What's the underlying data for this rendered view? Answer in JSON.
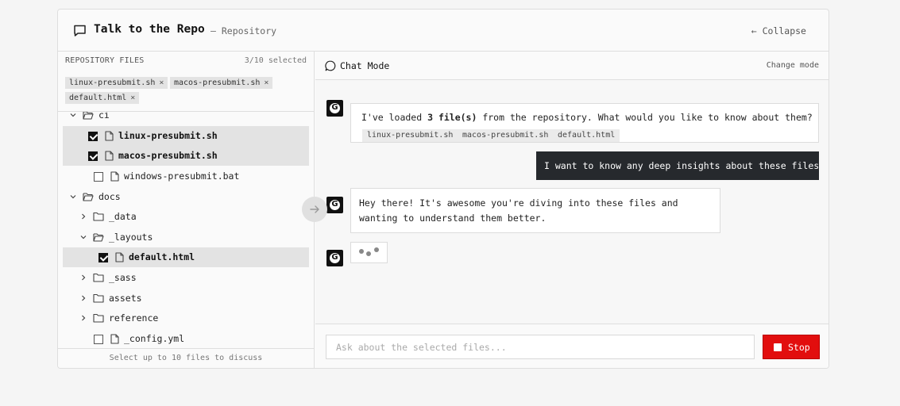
{
  "header": {
    "title": "Talk to the Repo",
    "subtitle": "— Repository",
    "collapse_label": "← Collapse",
    "icon": "chat-bubble-icon"
  },
  "files_panel": {
    "title": "REPOSITORY FILES",
    "selected_count": "3/10 selected",
    "chips": [
      "linux-presubmit.sh",
      "macos-presubmit.sh",
      "default.html"
    ],
    "chip_remove": "×",
    "tree": [
      {
        "label": "ci",
        "type": "folder",
        "expanded": true
      },
      {
        "label": "linux-presubmit.sh",
        "type": "file",
        "checked": true
      },
      {
        "label": "macos-presubmit.sh",
        "type": "file",
        "checked": true
      },
      {
        "label": "windows-presubmit.bat",
        "type": "file",
        "checked": false
      },
      {
        "label": "docs",
        "type": "folder",
        "expanded": true
      },
      {
        "label": "_data",
        "type": "folder",
        "expanded": false
      },
      {
        "label": "_layouts",
        "type": "folder",
        "expanded": true
      },
      {
        "label": "default.html",
        "type": "file",
        "checked": true
      },
      {
        "label": "_sass",
        "type": "folder",
        "expanded": false
      },
      {
        "label": "assets",
        "type": "folder",
        "expanded": false
      },
      {
        "label": "reference",
        "type": "folder",
        "expanded": false
      },
      {
        "label": "_config.yml",
        "type": "file",
        "checked": false
      }
    ],
    "footer": "Select up to 10 files to discuss"
  },
  "chat": {
    "mode_label": "Chat Mode",
    "change_mode": "Change mode",
    "avatar_letter": "G",
    "messages": {
      "m1_pre": "I've loaded ",
      "m1_bold": "3 file(s)",
      "m1_post": " from the repository. What would you like to know about them?",
      "m1_chips": [
        "linux-presubmit.sh",
        "macos-presubmit.sh",
        "default.html"
      ],
      "user": "I want to know any deep insights about these files",
      "m2": "Hey there! It's awesome you're diving into these files and wanting to understand them better."
    },
    "input_placeholder": "Ask about the selected files...",
    "stop_label": "Stop"
  },
  "colors": {
    "accent_stop": "#e20e0e",
    "user_bubble": "#26292d",
    "selected_row": "#e3e3e3"
  }
}
